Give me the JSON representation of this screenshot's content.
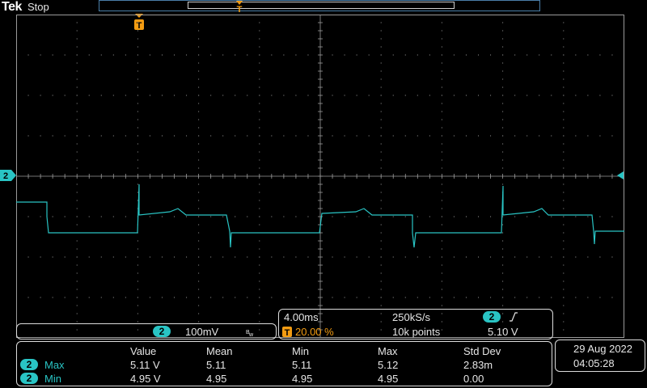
{
  "header": {
    "brand": "Tek",
    "status": "Stop"
  },
  "trigger": {
    "marker_label": "T"
  },
  "channel": {
    "marker": "2",
    "scale": "100mV",
    "bw_icon": "bandwidth-limit-icon"
  },
  "timebase": {
    "time_per_div": "4.00ms",
    "sample_rate": "250kS/s",
    "trigger_channel": "2",
    "trigger_slope_icon": "rising-edge-icon",
    "trigger_position": "20.00 %",
    "record_length": "10k points",
    "trigger_level": "5.10 V"
  },
  "measurements": {
    "headers": [
      "Value",
      "Mean",
      "Min",
      "Max",
      "Std Dev"
    ],
    "rows": [
      {
        "channel": "2",
        "name": "Max",
        "value": "5.11 V",
        "mean": "5.11",
        "min": "5.11",
        "max": "5.12",
        "std": "2.83m"
      },
      {
        "channel": "2",
        "name": "Min",
        "value": "4.95 V",
        "mean": "4.95",
        "min": "4.95",
        "max": "4.95",
        "std": "0.00"
      }
    ]
  },
  "datetime": {
    "date": "29 Aug  2022",
    "time": "04:05:28"
  },
  "colors": {
    "trace": "#29c4c4",
    "trigger": "#f39c12",
    "grid": "#9a9a9a"
  }
}
